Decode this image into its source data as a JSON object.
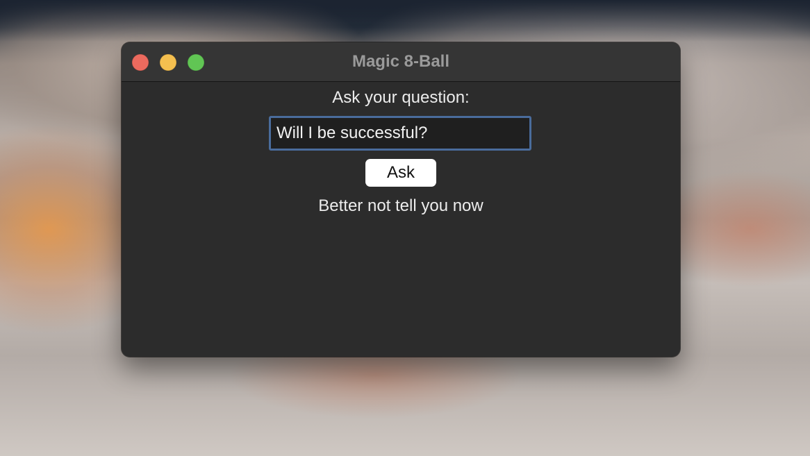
{
  "window": {
    "title": "Magic 8-Ball"
  },
  "form": {
    "prompt_label": "Ask your question:",
    "question_value": "Will I be successful?",
    "ask_label": "Ask"
  },
  "result": {
    "answer": "Better not tell you now"
  },
  "colors": {
    "window_bg": "#2c2c2c",
    "titlebar_bg": "#353535",
    "input_focus_border": "#4a6c9c",
    "close": "#ec6a5e",
    "minimize": "#f4bf4f",
    "maximize": "#61c554"
  }
}
